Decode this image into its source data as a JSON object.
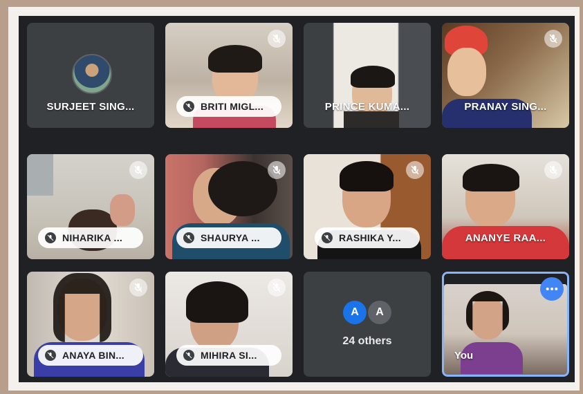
{
  "participants": [
    {
      "name": "SURJEET SING...",
      "style": "plain",
      "muted": false,
      "avatar": true
    },
    {
      "name": "BRITI MIGL...",
      "style": "pill",
      "muted": true
    },
    {
      "name": "PRINCE KUMA...",
      "style": "plain",
      "muted": false
    },
    {
      "name": "PRANAY SING...",
      "style": "plain",
      "muted": true
    },
    {
      "name": "NIHARIKA ...",
      "style": "pill",
      "muted": true
    },
    {
      "name": "SHAURYA ...",
      "style": "pill",
      "muted": true
    },
    {
      "name": "RASHIKA Y...",
      "style": "pill",
      "muted": true
    },
    {
      "name": "ANANYE RAA...",
      "style": "plain",
      "muted": true
    },
    {
      "name": "ANAYA BIN...",
      "style": "pill",
      "muted": true
    },
    {
      "name": "MIHIRA SI...",
      "style": "pill",
      "muted": true
    }
  ],
  "others": {
    "label": "24 others",
    "avatars": [
      "A",
      "A"
    ],
    "avatar_colors": [
      "#1a73e8",
      "#5f6368"
    ]
  },
  "self_tile": {
    "label": "You",
    "border_color": "#8ab4f8",
    "menu_icon": "more-horizontal-icon"
  },
  "icons": {
    "muted": "mic-off-icon",
    "pill": "mic-off-icon"
  },
  "colors": {
    "grid_background": "#202124",
    "tile_background": "#3c4043",
    "accent": "#4285f4"
  }
}
